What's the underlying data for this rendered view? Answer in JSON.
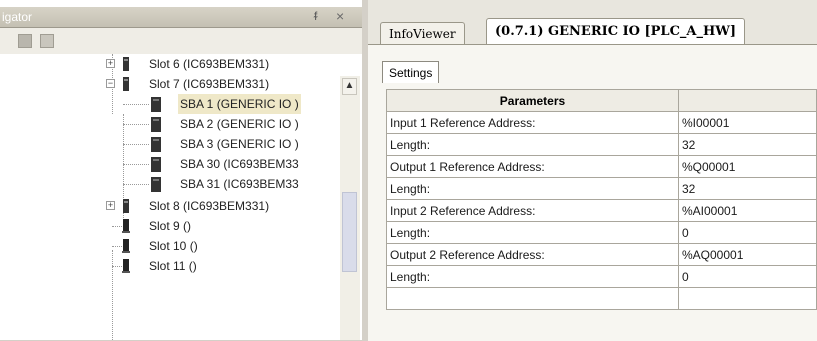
{
  "navigator": {
    "title": "igator",
    "pin_glyph": "ᵮ",
    "close_glyph": "×",
    "tree": [
      {
        "label": "Slot 6 (IC693BEM331)",
        "expander": "+",
        "selected": false
      },
      {
        "label": "Slot 7 (IC693BEM331)",
        "expander": "−",
        "selected": false
      },
      {
        "label": "SBA 1 (GENERIC IO )",
        "expander": "",
        "selected": true
      },
      {
        "label": "SBA 2 (GENERIC IO )",
        "expander": "",
        "selected": false
      },
      {
        "label": "SBA 3 (GENERIC IO )",
        "expander": "",
        "selected": false
      },
      {
        "label": "SBA 30 (IC693BEM33",
        "expander": "",
        "selected": false
      },
      {
        "label": "SBA 31 (IC693BEM33",
        "expander": "",
        "selected": false
      },
      {
        "label": "Slot 8 (IC693BEM331)",
        "expander": "+",
        "selected": false
      },
      {
        "label": "Slot 9 ()",
        "expander": "",
        "selected": false
      },
      {
        "label": "Slot 10 ()",
        "expander": "",
        "selected": false
      },
      {
        "label": "Slot 11 ()",
        "expander": "",
        "selected": false
      }
    ],
    "scroll_up_glyph": "▲"
  },
  "editor": {
    "tabs": [
      {
        "label": "InfoViewer",
        "active": false
      },
      {
        "label": "(0.7.1) GENERIC IO [PLC_A_HW]",
        "active": true
      }
    ],
    "sub_tab": "Settings",
    "grid": {
      "header": "Parameters",
      "rows": [
        {
          "param": "Input 1 Reference Address:",
          "value": "%I00001"
        },
        {
          "param": "Length:",
          "value": "32"
        },
        {
          "param": "Output 1 Reference Address:",
          "value": "%Q00001"
        },
        {
          "param": "Length:",
          "value": "32"
        },
        {
          "param": "Input 2 Reference Address:",
          "value": "%AI00001"
        },
        {
          "param": "Length:",
          "value": "0"
        },
        {
          "param": "Output 2 Reference Address:",
          "value": "%AQ00001"
        },
        {
          "param": "Length:",
          "value": "0"
        }
      ]
    }
  },
  "colors": {
    "selected_item_bg": "#efe8c8",
    "grid_border": "#a9a69c",
    "device_icon": "#333333"
  }
}
